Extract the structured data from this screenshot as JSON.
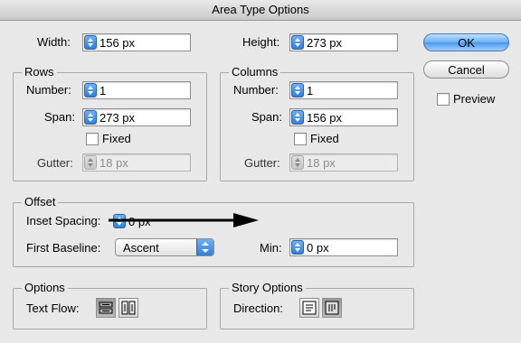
{
  "window": {
    "title": "Area Type Options"
  },
  "size": {
    "width_label": "Width:",
    "width_value": "156 px",
    "height_label": "Height:",
    "height_value": "273 px"
  },
  "buttons": {
    "ok": "OK",
    "cancel": "Cancel"
  },
  "preview": {
    "label": "Preview",
    "checked": false
  },
  "rows": {
    "title": "Rows",
    "number_label": "Number:",
    "number_value": "1",
    "span_label": "Span:",
    "span_value": "273 px",
    "fixed_label": "Fixed",
    "gutter_label": "Gutter:",
    "gutter_value": "18 px"
  },
  "columns": {
    "title": "Columns",
    "number_label": "Number:",
    "number_value": "1",
    "span_label": "Span:",
    "span_value": "156 px",
    "fixed_label": "Fixed",
    "gutter_label": "Gutter:",
    "gutter_value": "18 px"
  },
  "offset": {
    "title": "Offset",
    "inset_label": "Inset Spacing:",
    "inset_value": "0 px",
    "first_baseline_label": "First Baseline:",
    "first_baseline_value": "Ascent",
    "min_label": "Min:",
    "min_value": "0 px"
  },
  "options": {
    "title": "Options",
    "text_flow_label": "Text Flow:"
  },
  "story": {
    "title": "Story Options",
    "direction_label": "Direction:"
  },
  "icons": {
    "text_flow": [
      "text-flow-by-rows-icon",
      "text-flow-by-columns-icon"
    ],
    "direction": [
      "horizontal-direction-icon",
      "vertical-direction-icon"
    ]
  }
}
